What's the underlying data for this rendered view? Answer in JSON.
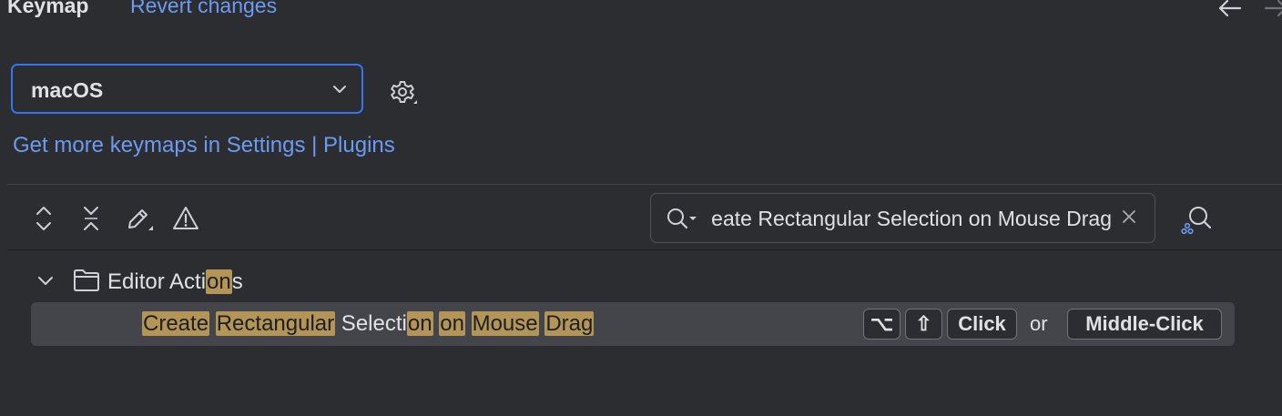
{
  "header": {
    "title": "Keymap",
    "revert_label": "Revert changes"
  },
  "keymap": {
    "selected": "macOS",
    "more_prefix": "Get more keymaps in Settings",
    "more_separator": "|",
    "more_plugins": "Plugins"
  },
  "search": {
    "value": "Create Rectangular Selection on Mouse Drag"
  },
  "tree": {
    "group": {
      "parts": [
        "Editor Acti",
        "on",
        "s"
      ]
    },
    "action": {
      "parts": {
        "p1": "Create",
        "s1": " ",
        "p2": "Rectangular",
        "s2": " Selecti",
        "p3": "on",
        "s3": " ",
        "p4": "on",
        "s4": " ",
        "p5": "Mouse",
        "s5": " ",
        "p6": "Drag"
      },
      "shortcut1": {
        "option_key": "⌥",
        "shift_key": "⇧",
        "click_key": "Click"
      },
      "or_text": "or",
      "shortcut2": "Middle-Click"
    }
  },
  "colors": {
    "accent": "#3574f0",
    "link": "#6d9bf1",
    "highlight": "#b39558",
    "selection_row": "#43454a"
  },
  "icons": [
    "arrow-left-icon",
    "arrow-right-icon",
    "chevron-down-icon",
    "gear-icon",
    "expand-all-icon",
    "collapse-all-icon",
    "edit-icon",
    "warning-icon",
    "search-icon",
    "clear-icon",
    "find-shortcut-icon",
    "folder-icon"
  ]
}
